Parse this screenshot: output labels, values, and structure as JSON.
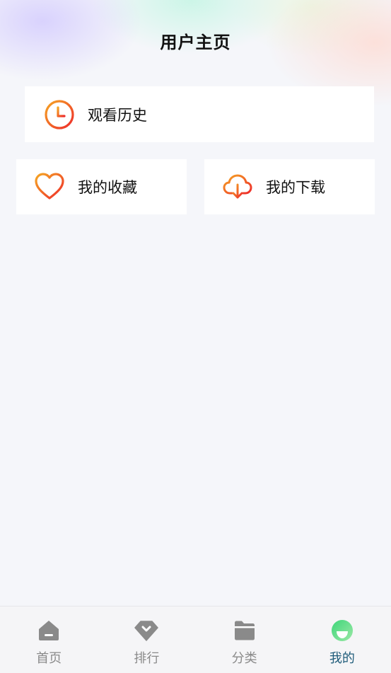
{
  "header": {
    "title": "用户主页"
  },
  "cards": {
    "history": {
      "label": "观看历史",
      "icon": "clock-icon"
    },
    "favorites": {
      "label": "我的收藏",
      "icon": "heart-icon"
    },
    "downloads": {
      "label": "我的下载",
      "icon": "cloud-download-icon"
    }
  },
  "tabbar": {
    "items": [
      {
        "label": "首页",
        "icon": "home-icon",
        "active": false
      },
      {
        "label": "排行",
        "icon": "ranking-icon",
        "active": false
      },
      {
        "label": "分类",
        "icon": "folder-icon",
        "active": false
      },
      {
        "label": "我的",
        "icon": "profile-icon",
        "active": true
      }
    ]
  },
  "colors": {
    "accent_gradient": [
      "#f5a623",
      "#ee2b2b"
    ],
    "tab_active": "#1f5c7a",
    "tab_inactive": "#8a8a8a",
    "profile_icon_gradient": [
      "#3fd67a",
      "#9be8a6"
    ]
  }
}
